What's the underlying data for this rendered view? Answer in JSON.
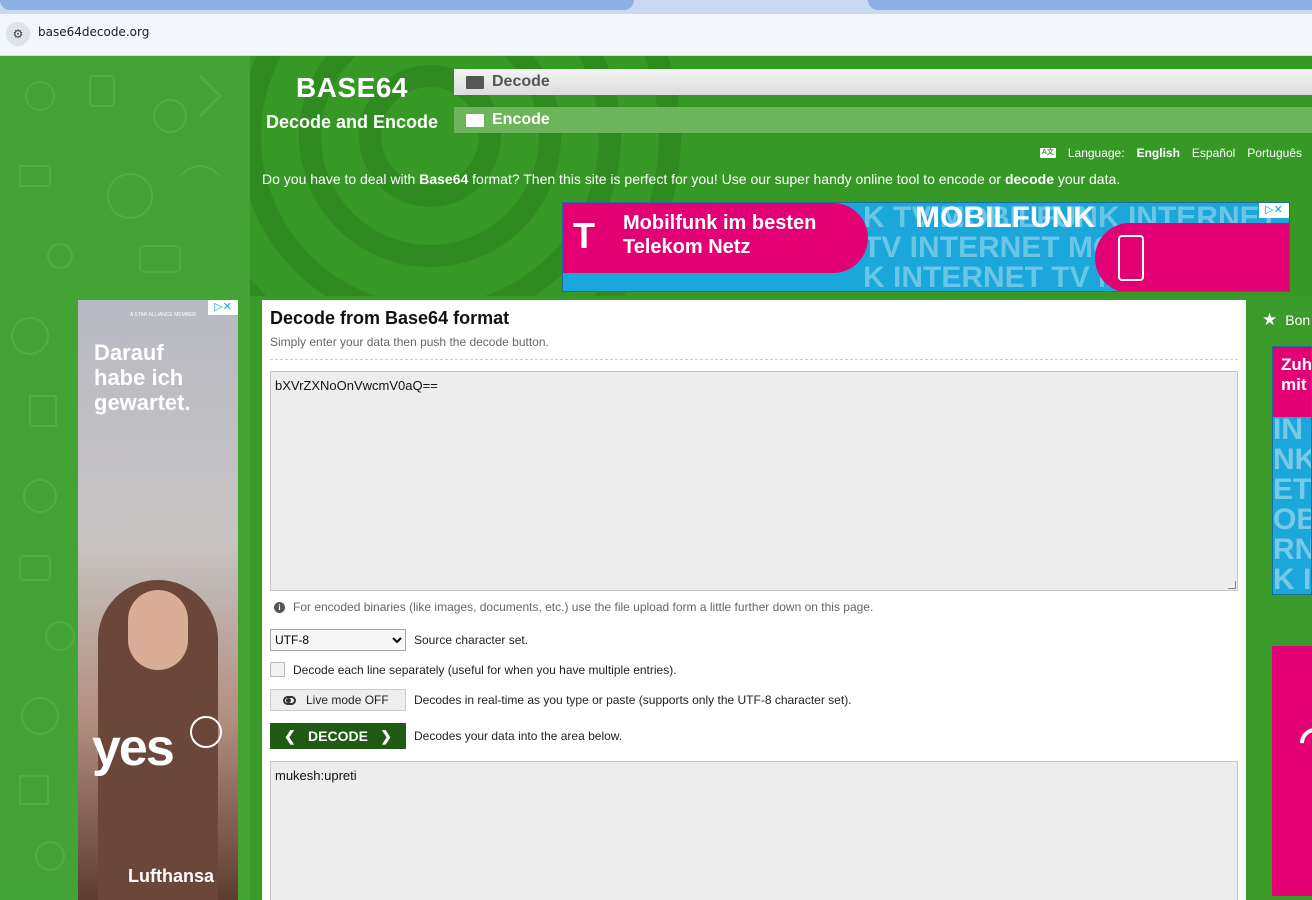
{
  "browser": {
    "url": "base64decode.org"
  },
  "site": {
    "brand_title": "BASE64",
    "brand_subtitle": "Decode and Encode",
    "nav": [
      {
        "label": "Decode",
        "active": true
      },
      {
        "label": "Encode",
        "active": false
      }
    ],
    "language": {
      "label": "Language:",
      "options": [
        "English",
        "Español",
        "Português"
      ],
      "selected": "English"
    },
    "intro": {
      "part1": "Do you have to deal with ",
      "bold1": "Base64",
      "part2": " format? Then this site is perfect for you! Use our super handy online tool to encode or ",
      "bold2": "decode",
      "part3": " your data."
    }
  },
  "banner_ad": {
    "logo": "T",
    "pill_text": "Mobilfunk im besten\nTelekom Netz",
    "headline": "MOBILFUNK",
    "bg_text": "K TV MOBILFUNK INTERNET TV\nTV INTERNET MOBILFUNK\nK INTERNET TV MOBILFUNK TV INTER",
    "colors": {
      "magenta": "#e20074",
      "cyan": "#1ba7d9"
    }
  },
  "left_ad": {
    "tag": "A STAR ALLIANCE MEMBER",
    "headline": "Darauf\nhabe ich\ngewartet.",
    "slogan": "yes",
    "brand": "Lufthansa"
  },
  "main": {
    "title": "Decode from Base64 format",
    "subtitle": "Simply enter your data then push the decode button.",
    "input_value": "bXVrZXNoOnVwcmV0aQ==",
    "note": "For encoded binaries (like images, documents, etc.) use the file upload form a little further down on this page.",
    "charset": {
      "selected": "UTF-8",
      "label": "Source character set."
    },
    "each_line": {
      "checked": false,
      "label": "Decode each line separately (useful for when you have multiple entries)."
    },
    "live_mode": {
      "button": "Live mode OFF",
      "label": "Decodes in real-time as you type or paste (supports only the UTF-8 character set)."
    },
    "decode": {
      "button": "DECODE",
      "label": "Decodes your data into the area below."
    },
    "output_value": "mukesh:upreti"
  },
  "right": {
    "bookmark_label": "Bon",
    "ad1_text": "Zuh\nmit",
    "ad1_bg": "IN\nNK\nET T\nOBI\nRN\nK IN"
  },
  "theme": {
    "green": "#3a9a2a",
    "dark_green_button": "#1f5b13"
  }
}
